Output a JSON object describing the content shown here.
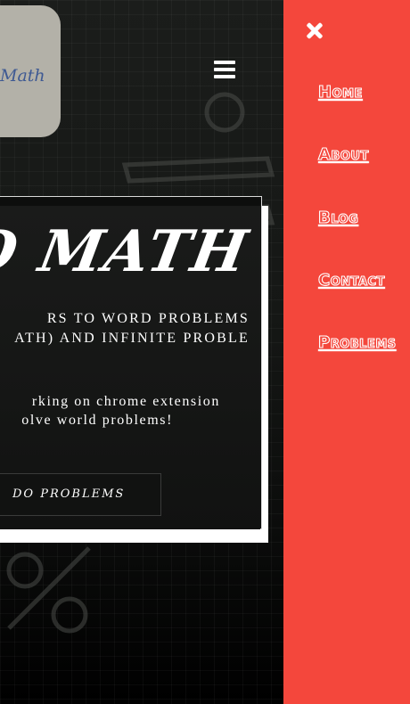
{
  "logo": {
    "text": "Math"
  },
  "hero": {
    "title": "D MATH",
    "subtitle_line1": "RS TO WORD PROBLEMS",
    "subtitle_line2": "ATH) AND INFINITE PROBLE",
    "note_line1": "rking on chrome extension",
    "note_line2": "olve world problems!",
    "cta_label": "DO PROBLEMS"
  },
  "menu": {
    "items": [
      {
        "label": "Home"
      },
      {
        "label": "About"
      },
      {
        "label": "Blog"
      },
      {
        "label": "Contact"
      },
      {
        "label": "Problems"
      }
    ]
  },
  "colors": {
    "menu_background": "#f4473c",
    "logo_card": "#b3b1a8",
    "logo_text": "#3f5a93"
  }
}
